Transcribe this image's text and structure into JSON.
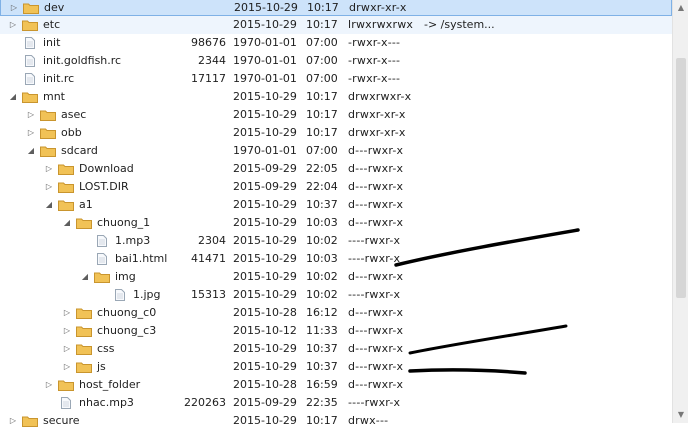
{
  "rows": [
    {
      "name": "dev",
      "type": "folder",
      "expanded": false,
      "indent": 0,
      "size": "",
      "date": "2015-10-29",
      "time": "10:17",
      "perm": "drwxr-xr-x",
      "info": "",
      "state": "selected"
    },
    {
      "name": "etc",
      "type": "folder",
      "expanded": false,
      "indent": 0,
      "size": "",
      "date": "2015-10-29",
      "time": "10:17",
      "perm": "lrwxrwxrwx",
      "info": "-> /system...",
      "state": "hover"
    },
    {
      "name": "init",
      "type": "file",
      "indent": 0,
      "size": "98676",
      "date": "1970-01-01",
      "time": "07:00",
      "perm": "-rwxr-x---",
      "info": ""
    },
    {
      "name": "init.goldfish.rc",
      "type": "file",
      "indent": 0,
      "size": "2344",
      "date": "1970-01-01",
      "time": "07:00",
      "perm": "-rwxr-x---",
      "info": ""
    },
    {
      "name": "init.rc",
      "type": "file",
      "indent": 0,
      "size": "17117",
      "date": "1970-01-01",
      "time": "07:00",
      "perm": "-rwxr-x---",
      "info": ""
    },
    {
      "name": "mnt",
      "type": "folder",
      "expanded": true,
      "indent": 0,
      "size": "",
      "date": "2015-10-29",
      "time": "10:17",
      "perm": "drwxrwxr-x",
      "info": ""
    },
    {
      "name": "asec",
      "type": "folder",
      "expanded": false,
      "indent": 1,
      "size": "",
      "date": "2015-10-29",
      "time": "10:17",
      "perm": "drwxr-xr-x",
      "info": ""
    },
    {
      "name": "obb",
      "type": "folder",
      "expanded": false,
      "indent": 1,
      "size": "",
      "date": "2015-10-29",
      "time": "10:17",
      "perm": "drwxr-xr-x",
      "info": ""
    },
    {
      "name": "sdcard",
      "type": "folder",
      "expanded": true,
      "indent": 1,
      "size": "",
      "date": "1970-01-01",
      "time": "07:00",
      "perm": "d---rwxr-x",
      "info": ""
    },
    {
      "name": "Download",
      "type": "folder",
      "expanded": false,
      "indent": 2,
      "size": "",
      "date": "2015-09-29",
      "time": "22:05",
      "perm": "d---rwxr-x",
      "info": ""
    },
    {
      "name": "LOST.DIR",
      "type": "folder",
      "expanded": false,
      "indent": 2,
      "size": "",
      "date": "2015-09-29",
      "time": "22:04",
      "perm": "d---rwxr-x",
      "info": ""
    },
    {
      "name": "a1",
      "type": "folder",
      "expanded": true,
      "indent": 2,
      "size": "",
      "date": "2015-10-29",
      "time": "10:37",
      "perm": "d---rwxr-x",
      "info": ""
    },
    {
      "name": "chuong_1",
      "type": "folder",
      "expanded": true,
      "indent": 3,
      "size": "",
      "date": "2015-10-29",
      "time": "10:03",
      "perm": "d---rwxr-x",
      "info": ""
    },
    {
      "name": "1.mp3",
      "type": "file",
      "indent": 4,
      "size": "2304",
      "date": "2015-10-29",
      "time": "10:02",
      "perm": "----rwxr-x",
      "info": ""
    },
    {
      "name": "bai1.html",
      "type": "file",
      "indent": 4,
      "size": "41471",
      "date": "2015-10-29",
      "time": "10:03",
      "perm": "----rwxr-x",
      "info": ""
    },
    {
      "name": "img",
      "type": "folder",
      "expanded": true,
      "indent": 4,
      "size": "",
      "date": "2015-10-29",
      "time": "10:02",
      "perm": "d---rwxr-x",
      "info": ""
    },
    {
      "name": "1.jpg",
      "type": "file",
      "indent": 5,
      "size": "15313",
      "date": "2015-10-29",
      "time": "10:02",
      "perm": "----rwxr-x",
      "info": ""
    },
    {
      "name": "chuong_c0",
      "type": "folder",
      "expanded": false,
      "indent": 3,
      "size": "",
      "date": "2015-10-28",
      "time": "16:12",
      "perm": "d---rwxr-x",
      "info": ""
    },
    {
      "name": "chuong_c3",
      "type": "folder",
      "expanded": false,
      "indent": 3,
      "size": "",
      "date": "2015-10-12",
      "time": "11:33",
      "perm": "d---rwxr-x",
      "info": ""
    },
    {
      "name": "css",
      "type": "folder",
      "expanded": false,
      "indent": 3,
      "size": "",
      "date": "2015-10-29",
      "time": "10:37",
      "perm": "d---rwxr-x",
      "info": ""
    },
    {
      "name": "js",
      "type": "folder",
      "expanded": false,
      "indent": 3,
      "size": "",
      "date": "2015-10-29",
      "time": "10:37",
      "perm": "d---rwxr-x",
      "info": ""
    },
    {
      "name": "host_folder",
      "type": "folder",
      "expanded": false,
      "indent": 2,
      "size": "",
      "date": "2015-10-28",
      "time": "16:59",
      "perm": "d---rwxr-x",
      "info": ""
    },
    {
      "name": "nhac.mp3",
      "type": "file",
      "indent": 2,
      "size": "220263",
      "date": "2015-09-29",
      "time": "22:35",
      "perm": "----rwxr-x",
      "info": ""
    },
    {
      "name": "secure",
      "type": "folder",
      "expanded": false,
      "indent": 0,
      "size": "",
      "date": "2015-10-29",
      "time": "10:17",
      "perm": "drwx---",
      "info": ""
    }
  ],
  "colors": {
    "folder": "#f1c256",
    "folder_edge": "#c9952e",
    "file_edge": "#9aa7b5",
    "select": "#cde3fa",
    "marker": "#000000"
  },
  "icons": {
    "folder": "folder-icon",
    "file": "file-icon",
    "expanded": "expanded-arrow-icon",
    "collapsed": "collapsed-arrow-icon"
  }
}
